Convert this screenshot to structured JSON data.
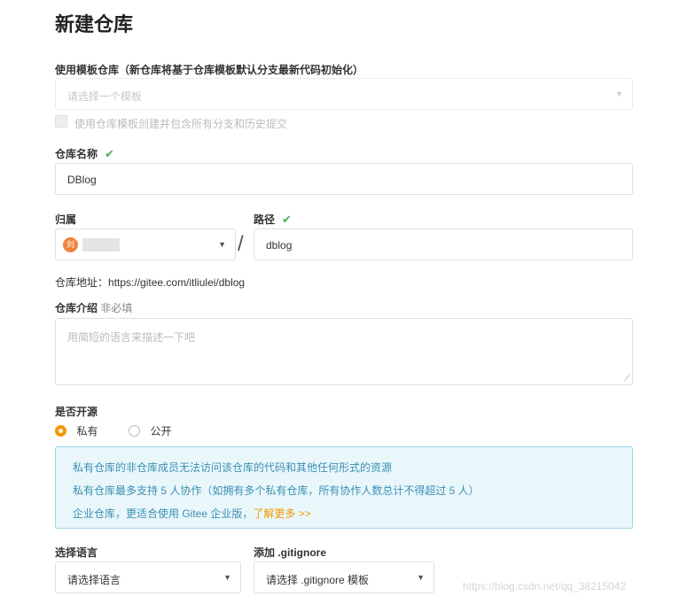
{
  "page": {
    "title": "新建仓库"
  },
  "template": {
    "label": "使用模板仓库（新仓库将基于仓库模板默认分支最新代码初始化）",
    "placeholder": "请选择一个模板",
    "include_branches_label": "使用仓库模板创建并包含所有分支和历史提交"
  },
  "repo_name": {
    "label": "仓库名称",
    "value": "DBlog"
  },
  "owner": {
    "label": "归属",
    "avatar_text": "刘"
  },
  "path": {
    "label": "路径",
    "value": "dblog",
    "separator": "/"
  },
  "repo_address": {
    "label": "仓库地址：",
    "url": "https://gitee.com/itliulei/dblog"
  },
  "description": {
    "label": "仓库介绍",
    "optional": "非必填",
    "placeholder": "用简短的语言来描述一下吧"
  },
  "visibility": {
    "label": "是否开源",
    "options": [
      {
        "label": "私有",
        "selected": true
      },
      {
        "label": "公开",
        "selected": false
      }
    ]
  },
  "info": {
    "line1": "私有仓库的非仓库成员无法访问该仓库的代码和其他任何形式的资源",
    "line2": "私有仓库最多支持 5 人协作（如拥有多个私有仓库，所有协作人数总计不得超过 5 人）",
    "line3": "企业仓库，更适合使用 Gitee 企业版，",
    "link": "了解更多 >>"
  },
  "language": {
    "label": "选择语言",
    "value": "请选择语言"
  },
  "gitignore": {
    "label": "添加 .gitignore",
    "value": "请选择 .gitignore 模板"
  },
  "watermark": "https://blog.csdn.net/qq_38215042",
  "colors": {
    "accent": "#f39800",
    "check": "#4caf50",
    "info_text": "#3c8fb3"
  }
}
